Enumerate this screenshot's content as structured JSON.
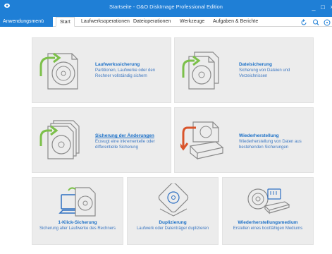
{
  "window": {
    "title": "Startseite - O&O DiskImage Professional Edition",
    "controls": [
      "_",
      "□",
      "×"
    ]
  },
  "ribbon": {
    "app_menu": "Anwendungsmenü",
    "tabs": [
      "Start",
      "Laufwerksoperationen",
      "Dateioperationen",
      "Werkzeuge",
      "Aufgaben & Berichte"
    ],
    "active_tab": "Start"
  },
  "tiles": [
    {
      "id": "laufwerkssicherung",
      "title": "Laufwerkssicherung",
      "desc": "Partitionen, Laufwerke oder den Rechner vollständig sichern",
      "icon": "drive-backup-icon"
    },
    {
      "id": "dateisicherung",
      "title": "Dateisicherung",
      "desc": "Sicherung von Dateien und Verzeichnissen",
      "icon": "file-backup-icon"
    },
    {
      "id": "aenderungen",
      "title": "Sicherung der Änderungen",
      "desc": "Erzeugt eine inkrementelle oder differentielle Sicherung",
      "icon": "incremental-backup-icon"
    },
    {
      "id": "wiederherstellung",
      "title": "Wiederherstellung",
      "desc": "Wiederherstellung von Daten aus bestehenden Sicherungen",
      "icon": "restore-icon"
    },
    {
      "id": "klick",
      "title": "1-Klick-Sicherung",
      "desc": "Sicherung aller Laufwerke des Rechners",
      "icon": "one-click-backup-icon"
    },
    {
      "id": "duplizierung",
      "title": "Duplizierung",
      "desc": "Laufwerk oder Datenträger duplizieren",
      "icon": "duplicate-icon"
    },
    {
      "id": "medium",
      "title": "Wiederherstellungsmedium",
      "desc": "Erstellen eines bootfähigen Mediums",
      "icon": "boot-media-icon"
    }
  ],
  "colors": {
    "titlebar": "#1f7fd6",
    "tile_bg": "#ececec",
    "link_blue": "#1a6fc7",
    "arrow_green": "#7cc04a",
    "arrow_red": "#d9542b"
  }
}
